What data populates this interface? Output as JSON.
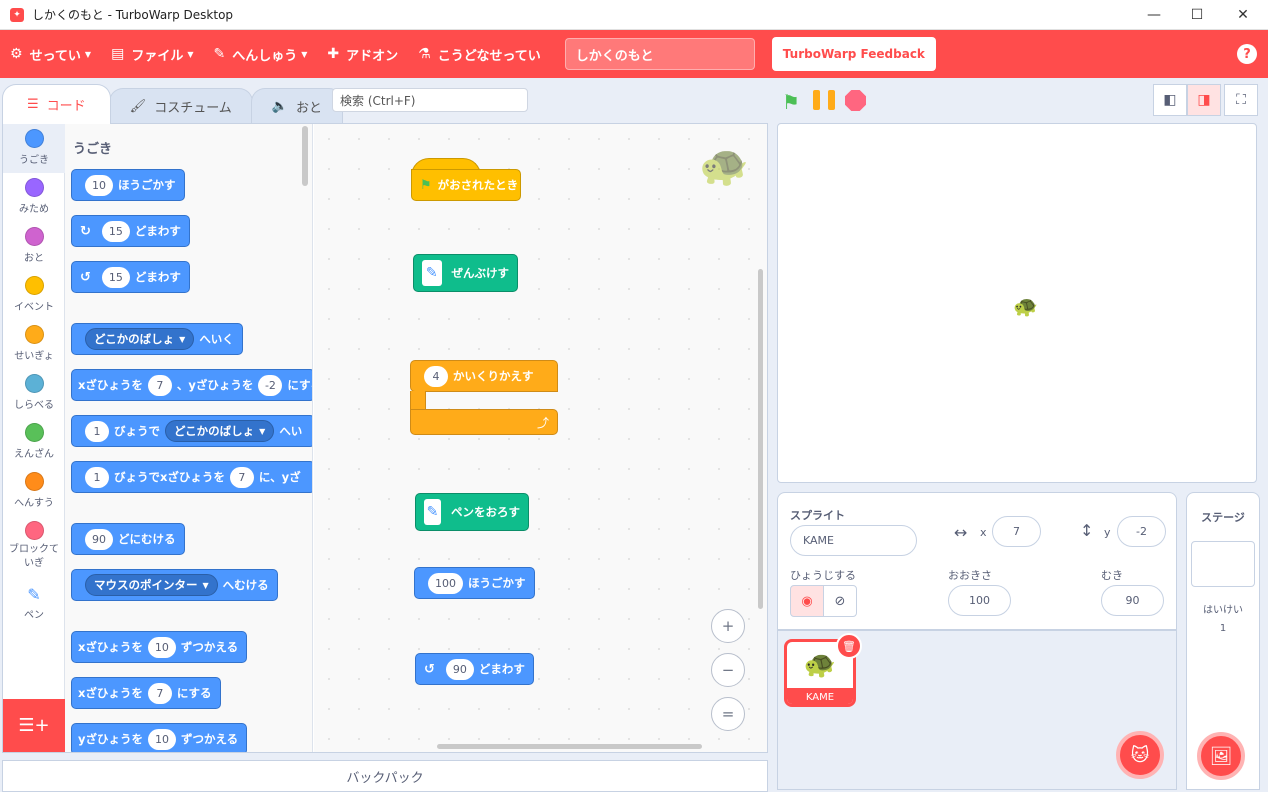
{
  "window": {
    "title": "しかくのもと - TurboWarp Desktop",
    "minimize": "—",
    "maximize": "☐",
    "close": "✕"
  },
  "menubar": {
    "settings": "せってい",
    "file": "ファイル",
    "edit": "へんしゅう",
    "addons": "アドオン",
    "how_to": "こうどなせってい",
    "project_title": "しかくのもと",
    "feedback": "TurboWarp Feedback",
    "help": "?"
  },
  "tabs": [
    {
      "label": "コード",
      "icon": "code-icon"
    },
    {
      "label": "コスチューム",
      "icon": "brush-icon"
    },
    {
      "label": "おと",
      "icon": "speaker-icon"
    }
  ],
  "search": {
    "placeholder": "検索 (Ctrl+F)"
  },
  "categories": [
    {
      "label": "うごき",
      "color": "#4c97ff"
    },
    {
      "label": "みため",
      "color": "#9966ff"
    },
    {
      "label": "おと",
      "color": "#cf63cf"
    },
    {
      "label": "イベント",
      "color": "#ffbf00"
    },
    {
      "label": "せいぎょ",
      "color": "#ffab19"
    },
    {
      "label": "しらべる",
      "color": "#5cb1d6"
    },
    {
      "label": "えんざん",
      "color": "#59c059"
    },
    {
      "label": "へんすう",
      "color": "#ff8c1a"
    },
    {
      "label": "ブロックていぎ",
      "color": "#ff6680"
    },
    {
      "label": "ペン",
      "color": "#0fbd8c"
    }
  ],
  "palette": {
    "heading": "うごき",
    "move": {
      "value": "10",
      "text": "ほうごかす"
    },
    "turn_right": {
      "value": "15",
      "text": "どまわす"
    },
    "turn_left": {
      "value": "15",
      "text": "どまわす"
    },
    "goto": {
      "dropdown": "どこかのばしょ",
      "text": "へいく"
    },
    "goto_xy": {
      "t1": "xざひょうを",
      "x": "7",
      "t2": "、yざひょうを",
      "y": "-2",
      "t3": "にする"
    },
    "glide": {
      "value": "1",
      "t1": "びょうで",
      "dropdown": "どこかのばしょ",
      "t2": "へい"
    },
    "glide_xy": {
      "value": "1",
      "t1": "びょうでxざひょうを",
      "x": "7",
      "t2": "に、yざ"
    },
    "point_dir": {
      "value": "90",
      "text": "どにむける"
    },
    "point_toward": {
      "dropdown": "マウスのポインター",
      "text": "へむける"
    },
    "change_x": {
      "t1": "xざひょうを",
      "value": "10",
      "t2": "ずつかえる"
    },
    "set_x": {
      "t1": "xざひょうを",
      "value": "7",
      "t2": "にする"
    },
    "change_y": {
      "t1": "yざひょうを",
      "value": "10",
      "t2": "ずつかえる"
    }
  },
  "script": {
    "flag_hat": "がおされたとき",
    "clear": "ぜんぶけす",
    "repeat": {
      "value": "4",
      "text": "かいくりかえす"
    },
    "pen_down": "ペンをおろす",
    "move": {
      "value": "100",
      "text": "ほうごかす"
    },
    "turn": {
      "value": "90",
      "text": "どまわす"
    }
  },
  "zoom": {
    "in": "+",
    "out": "−",
    "reset": "="
  },
  "backpack": "バックパック",
  "sprite_info": {
    "sprite_label": "スプライト",
    "sprite_name": "KAME",
    "x_label": "x",
    "x_value": "7",
    "y_label": "y",
    "y_value": "-2",
    "show_label": "ひょうじする",
    "size_label": "おおきさ",
    "size_value": "100",
    "direction_label": "むき",
    "direction_value": "90"
  },
  "sprites": [
    {
      "name": "KAME"
    }
  ],
  "stage_panel": {
    "title": "ステージ",
    "backdrops_label": "はいけい",
    "backdrops_count": "1"
  },
  "colors": {
    "accent": "#ff4c4c",
    "motion": "#4c97ff",
    "pen": "#0fbd8c",
    "control": "#ffab19",
    "event": "#ffbf00"
  }
}
